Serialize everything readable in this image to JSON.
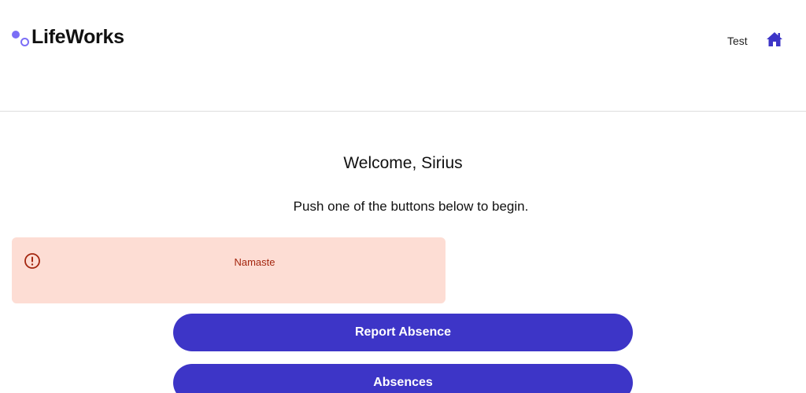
{
  "header": {
    "logo_text": "LifeWorks",
    "user_name": "Test",
    "home_icon": "home-icon",
    "brand_color": "#3d35c7",
    "logo_accent": "#7b6ef6"
  },
  "main": {
    "welcome": "Welcome, Sirius",
    "subtitle": "Push one of the buttons below to begin.",
    "alert": {
      "icon": "exclamation-circle-icon",
      "message": "Namaste",
      "background": "#fdddd4",
      "color": "#a4260f"
    },
    "buttons": [
      {
        "label": "Report Absence"
      },
      {
        "label": "Absences"
      }
    ]
  }
}
